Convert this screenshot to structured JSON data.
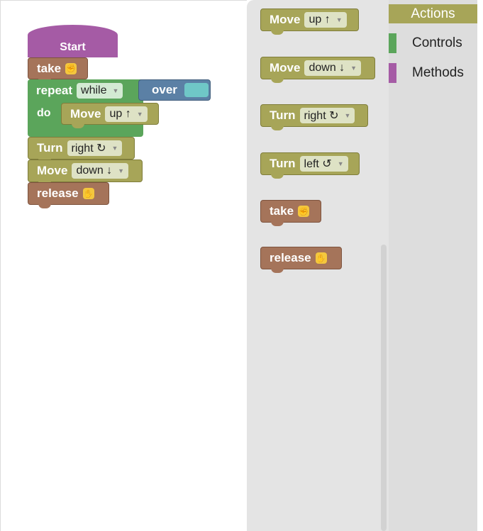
{
  "workspace": {
    "start_label": "Start",
    "program": [
      {
        "label": "take",
        "icon": "fist-icon"
      },
      {
        "label": "repeat",
        "mode": "while",
        "condition": "over",
        "do_label": "do",
        "inner": {
          "label": "Move",
          "direction": "up ↑"
        }
      },
      {
        "label": "Turn",
        "direction": "right ↻"
      },
      {
        "label": "Move",
        "direction": "down ↓"
      },
      {
        "label": "release",
        "icon": "open-hand-icon"
      }
    ]
  },
  "flyout": {
    "blocks": [
      {
        "label": "Move",
        "value": "up ↑"
      },
      {
        "label": "Move",
        "value": "down ↓"
      },
      {
        "label": "Turn",
        "value": "right ↻"
      },
      {
        "label": "Turn",
        "value": "left ↺"
      },
      {
        "label": "take",
        "icon": "fist-icon"
      },
      {
        "label": "release",
        "icon": "open-hand-icon"
      }
    ]
  },
  "toolbox": {
    "categories": [
      {
        "label": "Actions",
        "color": "#a7a558",
        "selected": true
      },
      {
        "label": "Controls",
        "color": "#5ba55b",
        "selected": false
      },
      {
        "label": "Methods",
        "color": "#a55ba5",
        "selected": false
      }
    ]
  },
  "colors": {
    "actions": "#a7a558",
    "hand": "#a5745a",
    "controls": "#5ba55b",
    "methods": "#a55ba5",
    "sensor": "#5b80a5"
  }
}
